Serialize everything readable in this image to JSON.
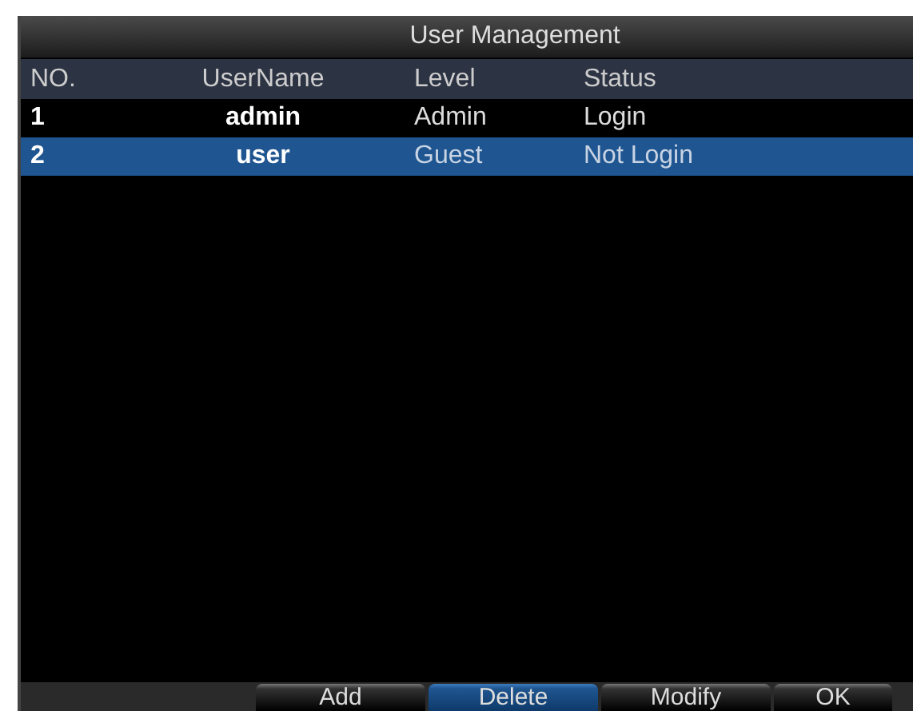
{
  "window": {
    "title": "User Management"
  },
  "table": {
    "columns": [
      "NO.",
      "UserName",
      "Level",
      "Status"
    ],
    "rows": [
      {
        "no": "1",
        "username": "admin",
        "level": "Admin",
        "status": "Login",
        "selected": false
      },
      {
        "no": "2",
        "username": "user",
        "level": "Guest",
        "status": "Not Login",
        "selected": true
      }
    ]
  },
  "buttons": [
    {
      "label": "Add",
      "selected": false
    },
    {
      "label": "Delete",
      "selected": true
    },
    {
      "label": "Modify",
      "selected": false
    },
    {
      "label": "OK",
      "selected": false
    }
  ]
}
